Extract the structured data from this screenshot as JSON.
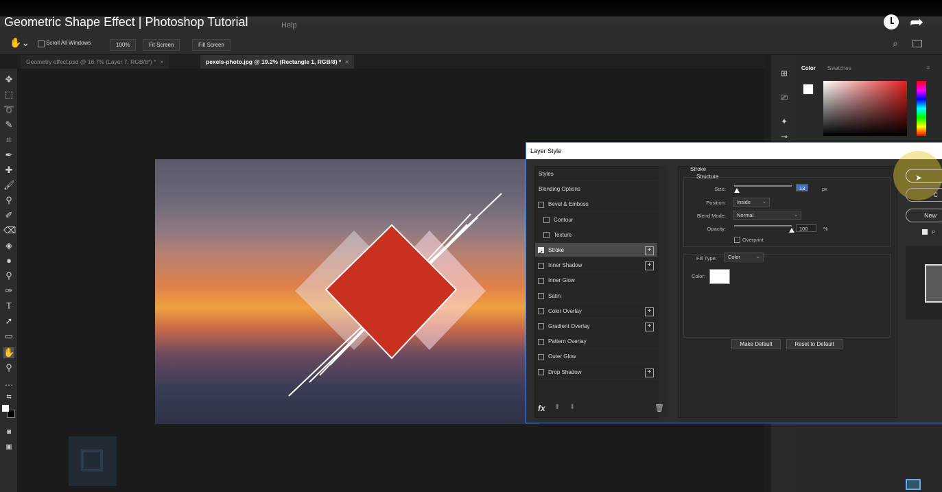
{
  "video": {
    "title": "Geometric Shape Effect | Photoshop Tutorial"
  },
  "menu": {
    "help": "Help"
  },
  "options_bar": {
    "scroll_all_windows": "Scroll All Windows",
    "zoom": "100%",
    "fit_screen": "Fit Screen",
    "fill_screen": "Fill Screen"
  },
  "tabs": [
    {
      "label": "Geometry effect.psd @ 16.7% (Layer 7, RGB/8*) *",
      "close": "×"
    },
    {
      "label": "pexels-photo.jpg @ 19.2% (Rectangle 1, RGB/8) *",
      "close": "×"
    }
  ],
  "color_panel": {
    "tab_color": "Color",
    "tab_swatches": "Swatches"
  },
  "dialog": {
    "title": "Layer Style",
    "styles": [
      {
        "label": "Styles",
        "checkbox": false,
        "checked": false,
        "plus": false,
        "indent": false
      },
      {
        "label": "Blending Options",
        "checkbox": false,
        "checked": false,
        "plus": false,
        "indent": false
      },
      {
        "label": "Bevel & Emboss",
        "checkbox": true,
        "checked": false,
        "plus": false,
        "indent": false
      },
      {
        "label": "Contour",
        "checkbox": true,
        "checked": false,
        "plus": false,
        "indent": true
      },
      {
        "label": "Texture",
        "checkbox": true,
        "checked": false,
        "plus": false,
        "indent": true
      },
      {
        "label": "Stroke",
        "checkbox": true,
        "checked": true,
        "plus": true,
        "indent": false,
        "selected": true
      },
      {
        "label": "Inner Shadow",
        "checkbox": true,
        "checked": false,
        "plus": true,
        "indent": false
      },
      {
        "label": "Inner Glow",
        "checkbox": true,
        "checked": false,
        "plus": false,
        "indent": false
      },
      {
        "label": "Satin",
        "checkbox": true,
        "checked": false,
        "plus": false,
        "indent": false
      },
      {
        "label": "Color Overlay",
        "checkbox": true,
        "checked": false,
        "plus": true,
        "indent": false
      },
      {
        "label": "Gradient Overlay",
        "checkbox": true,
        "checked": false,
        "plus": true,
        "indent": false
      },
      {
        "label": "Pattern Overlay",
        "checkbox": true,
        "checked": false,
        "plus": false,
        "indent": false
      },
      {
        "label": "Outer Glow",
        "checkbox": true,
        "checked": false,
        "plus": false,
        "indent": false
      },
      {
        "label": "Drop Shadow",
        "checkbox": true,
        "checked": false,
        "plus": true,
        "indent": false
      }
    ],
    "fx_label": "fx",
    "stroke": {
      "section": "Stroke",
      "structure": "Structure",
      "size_label": "Size:",
      "size_value": "13",
      "size_unit": "px",
      "position_label": "Position:",
      "position_value": "Inside",
      "blend_mode_label": "Blend Mode:",
      "blend_mode_value": "Normal",
      "opacity_label": "Opacity:",
      "opacity_value": "100",
      "opacity_unit": "%",
      "overprint_label": "Overprint",
      "fill_type_label": "Fill Type:",
      "fill_type_value": "Color",
      "color_label": "Color:",
      "stroke_color": "#ffffff",
      "size_fraction": 0.05,
      "opacity_fraction": 1.0
    },
    "make_default": "Make Default",
    "reset_default": "Reset to Default",
    "right_buttons": {
      "cancel_partial": "C",
      "new_partial": "New",
      "preview_partial": "P"
    }
  },
  "colors": {
    "accent": "#4a8ad6",
    "diamond": "#c8301f"
  }
}
